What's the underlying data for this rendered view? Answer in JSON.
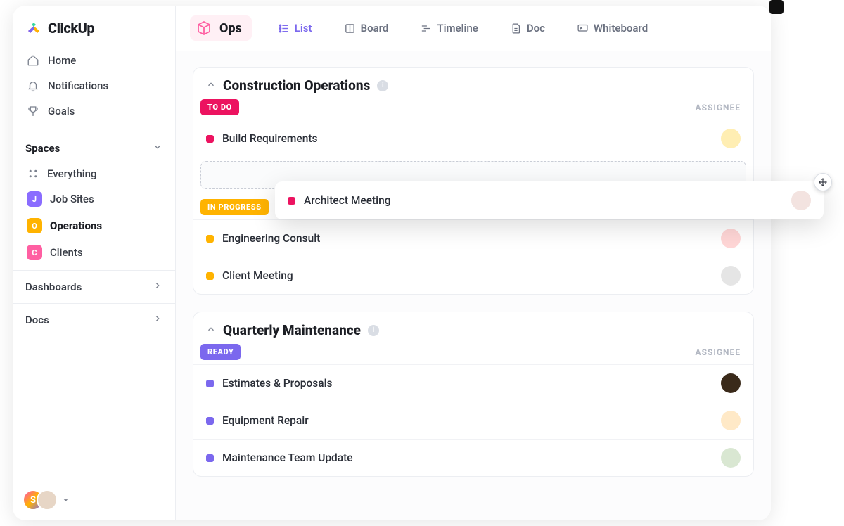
{
  "brand": {
    "name": "ClickUp"
  },
  "sidebar": {
    "nav": [
      {
        "label": "Home",
        "icon": "home-icon"
      },
      {
        "label": "Notifications",
        "icon": "bell-icon"
      },
      {
        "label": "Goals",
        "icon": "trophy-icon"
      }
    ],
    "spaces_header": "Spaces",
    "spaces": [
      {
        "label": "Everything",
        "icon": "grid-icon",
        "color": "#c9cdd6",
        "text_color": "#7b818e"
      },
      {
        "label": "Job Sites",
        "badge": "J",
        "color": "#8a6cff"
      },
      {
        "label": "Operations",
        "badge": "O",
        "color": "#ffb300",
        "active": true
      },
      {
        "label": "Clients",
        "badge": "C",
        "color": "#ff5fa2"
      }
    ],
    "sections": {
      "dashboards": "Dashboards",
      "docs": "Docs"
    },
    "user_stack": {
      "initial": "S"
    }
  },
  "toolbar": {
    "space_name": "Ops",
    "views": [
      {
        "label": "List",
        "icon": "list-icon",
        "active": true
      },
      {
        "label": "Board",
        "icon": "board-icon"
      },
      {
        "label": "Timeline",
        "icon": "timeline-icon"
      },
      {
        "label": "Doc",
        "icon": "doc-icon"
      },
      {
        "label": "Whiteboard",
        "icon": "whiteboard-icon"
      }
    ]
  },
  "groups": [
    {
      "title": "Construction Operations",
      "assignee_label": "ASSIGNEE",
      "sections": [
        {
          "status_label": "TO DO",
          "status_color": "#ec1360",
          "dot_color": "#ec1360",
          "tasks": [
            {
              "name": "Build Requirements",
              "avatar_bg": "#ffeeb3"
            }
          ],
          "dropzone": true
        },
        {
          "status_label": "IN PROGRESS",
          "status_color": "#ffb300",
          "dot_color": "#ffb300",
          "tasks": [
            {
              "name": "Engineering Consult",
              "avatar_bg": "#ffd6d6"
            },
            {
              "name": "Client Meeting",
              "avatar_bg": "#e5e5e5"
            }
          ]
        }
      ]
    },
    {
      "title": "Quarterly Maintenance",
      "assignee_label": "ASSIGNEE",
      "sections": [
        {
          "status_label": "READY",
          "status_color": "#7b68ee",
          "dot_color": "#7b68ee",
          "tasks": [
            {
              "name": "Estimates & Proposals",
              "avatar_bg": "#3a2a1a"
            },
            {
              "name": "Equipment Repair",
              "avatar_bg": "#ffe9c7"
            },
            {
              "name": "Maintenance Team Update",
              "avatar_bg": "#d9e7d2"
            }
          ]
        }
      ]
    }
  ],
  "dragging": {
    "name": "Architect Meeting",
    "dot_color": "#ec1360",
    "avatar_bg": "#f3e3e0"
  },
  "colors": {
    "accent": "#7b68ee"
  }
}
